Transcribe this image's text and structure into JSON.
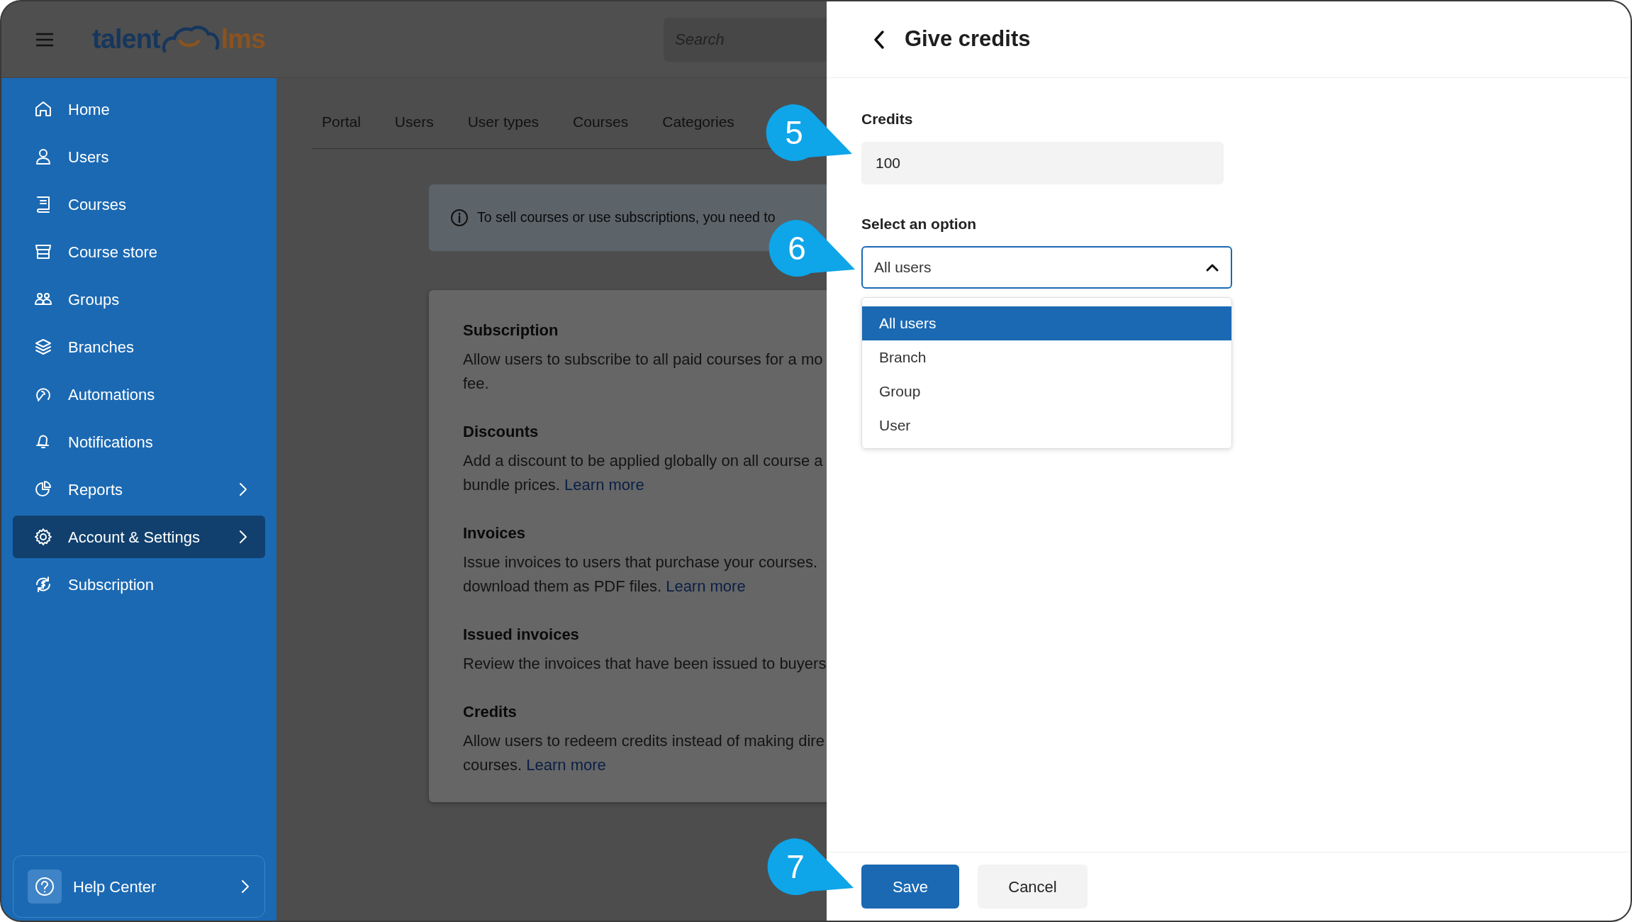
{
  "header": {
    "logo": {
      "left": "talent",
      "right": "lms"
    },
    "search": {
      "placeholder": "Search"
    }
  },
  "sidebar": {
    "items": [
      {
        "label": "Home",
        "selected": false,
        "has_submenu": false
      },
      {
        "label": "Users",
        "selected": false,
        "has_submenu": false
      },
      {
        "label": "Courses",
        "selected": false,
        "has_submenu": false
      },
      {
        "label": "Course store",
        "selected": false,
        "has_submenu": false
      },
      {
        "label": "Groups",
        "selected": false,
        "has_submenu": false
      },
      {
        "label": "Branches",
        "selected": false,
        "has_submenu": false
      },
      {
        "label": "Automations",
        "selected": false,
        "has_submenu": false
      },
      {
        "label": "Notifications",
        "selected": false,
        "has_submenu": false
      },
      {
        "label": "Reports",
        "selected": false,
        "has_submenu": true
      },
      {
        "label": "Account & Settings",
        "selected": true,
        "has_submenu": true
      },
      {
        "label": "Subscription",
        "selected": false,
        "has_submenu": false
      }
    ],
    "help": {
      "label": "Help Center"
    }
  },
  "tabs": [
    {
      "label": "Portal"
    },
    {
      "label": "Users"
    },
    {
      "label": "User types"
    },
    {
      "label": "Courses"
    },
    {
      "label": "Categories"
    }
  ],
  "notice": "To sell courses or use subscriptions, you need to",
  "sections": [
    {
      "title": "Subscription",
      "lines": [
        "Allow users to subscribe to all paid courses for a mo",
        "fee."
      ]
    },
    {
      "title": "Discounts",
      "lines": [
        "Add a discount to be applied globally on all course a",
        "bundle prices."
      ],
      "link": "Learn more"
    },
    {
      "title": "Invoices",
      "lines": [
        "Issue invoices to users that purchase your courses.",
        "download them as PDF files."
      ],
      "link": "Learn more"
    },
    {
      "title": "Issued invoices",
      "lines": [
        "Review the invoices that have been issued to buyers"
      ]
    },
    {
      "title": "Credits",
      "lines": [
        "Allow users to redeem credits instead of making dire",
        "courses."
      ],
      "link": "Learn more"
    }
  ],
  "panel": {
    "title": "Give credits",
    "credits": {
      "label": "Credits",
      "value": "100"
    },
    "select": {
      "label": "Select an option",
      "value": "All users",
      "expanded": true,
      "options": [
        {
          "label": "All users",
          "selected": true
        },
        {
          "label": "Branch",
          "selected": false
        },
        {
          "label": "Group",
          "selected": false
        },
        {
          "label": "User",
          "selected": false
        }
      ]
    },
    "buttons": [
      {
        "label": "Save",
        "kind": "primary"
      },
      {
        "label": "Cancel",
        "kind": "secondary"
      }
    ]
  },
  "steps": [
    "5",
    "6",
    "7"
  ]
}
